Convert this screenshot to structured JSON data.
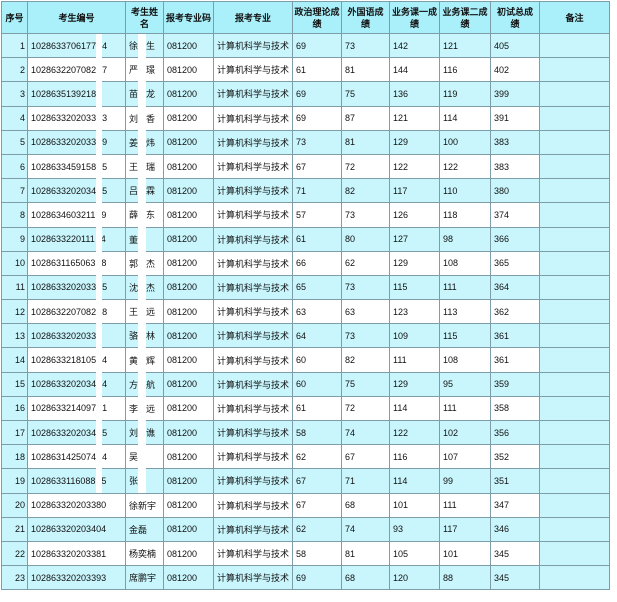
{
  "theme": {
    "header_bg": "#a9f0fb",
    "row_alt_bg": "#c9f6fd",
    "grid": "#7d9ea8"
  },
  "table": {
    "headers": [
      "序号",
      "考生编号",
      "考生姓名",
      "报考专业码",
      "报考专业",
      "政治理论成绩",
      "外国语成绩",
      "业务课一成绩",
      "业务课二成绩",
      "初试总成绩",
      "备注"
    ],
    "rows": [
      {
        "seq": "1",
        "id": "1028633706177",
        "id_tail": "4",
        "name": "徐",
        "name_tail": "生",
        "major_code": "081200",
        "major": "计算机科学与技术",
        "politics": "69",
        "foreign_language": "73",
        "course1": "142",
        "course2": "121",
        "total": "405"
      },
      {
        "seq": "2",
        "id": "1028632207082",
        "id_tail": "7",
        "name": "严",
        "name_tail": "璟",
        "major_code": "081200",
        "major": "计算机科学与技术",
        "politics": "61",
        "foreign_language": "81",
        "course1": "144",
        "course2": "116",
        "total": "402"
      },
      {
        "seq": "3",
        "id": "1028635139218",
        "name": "苗",
        "name_tail": "龙",
        "major_code": "081200",
        "major": "计算机科学与技术",
        "politics": "69",
        "foreign_language": "75",
        "course1": "136",
        "course2": "119",
        "total": "399"
      },
      {
        "seq": "4",
        "id": "1028633202033",
        "id_tail": "3",
        "name": "刘",
        "name_tail": "香",
        "major_code": "081200",
        "major": "计算机科学与技术",
        "politics": "69",
        "foreign_language": "87",
        "course1": "121",
        "course2": "114",
        "total": "391"
      },
      {
        "seq": "5",
        "id": "1028633202033",
        "id_tail": "9",
        "name": "姜",
        "name_tail": "炜",
        "major_code": "081200",
        "major": "计算机科学与技术",
        "politics": "73",
        "foreign_language": "81",
        "course1": "129",
        "course2": "100",
        "total": "383"
      },
      {
        "seq": "6",
        "id": "1028633459158",
        "id_tail": "5",
        "name": "王",
        "name_tail": "瑞",
        "major_code": "081200",
        "major": "计算机科学与技术",
        "politics": "67",
        "foreign_language": "72",
        "course1": "122",
        "course2": "122",
        "total": "383"
      },
      {
        "seq": "7",
        "id": "1028633202034",
        "id_tail": "5",
        "name": "吕",
        "name_tail": "霖",
        "major_code": "081200",
        "major": "计算机科学与技术",
        "politics": "71",
        "foreign_language": "82",
        "course1": "117",
        "course2": "110",
        "total": "380"
      },
      {
        "seq": "8",
        "id": "1028634603211",
        "id_tail": "9",
        "name": "薛",
        "name_tail": "东",
        "major_code": "081200",
        "major": "计算机科学与技术",
        "politics": "57",
        "foreign_language": "73",
        "course1": "126",
        "course2": "118",
        "total": "374"
      },
      {
        "seq": "9",
        "id": "1028633220111",
        "id_tail": "4",
        "name": "董",
        "major_code": "081200",
        "major": "计算机科学与技术",
        "politics": "61",
        "foreign_language": "80",
        "course1": "127",
        "course2": "98",
        "total": "366"
      },
      {
        "seq": "10",
        "id": "1028631165063",
        "id_tail": "8",
        "name": "郭",
        "name_tail": "杰",
        "major_code": "081200",
        "major": "计算机科学与技术",
        "politics": "66",
        "foreign_language": "62",
        "course1": "129",
        "course2": "108",
        "total": "365"
      },
      {
        "seq": "11",
        "id": "1028633202033",
        "id_tail": "5",
        "name": "沈",
        "name_tail": "杰",
        "major_code": "081200",
        "major": "计算机科学与技术",
        "politics": "65",
        "foreign_language": "73",
        "course1": "115",
        "course2": "111",
        "total": "364"
      },
      {
        "seq": "12",
        "id": "1028632207082",
        "id_tail": "8",
        "name": "王",
        "name_tail": "远",
        "major_code": "081200",
        "major": "计算机科学与技术",
        "politics": "63",
        "foreign_language": "63",
        "course1": "123",
        "course2": "113",
        "total": "362"
      },
      {
        "seq": "13",
        "id": "1028633202033",
        "name": "骆",
        "name_tail": "林",
        "major_code": "081200",
        "major": "计算机科学与技术",
        "politics": "64",
        "foreign_language": "73",
        "course1": "109",
        "course2": "115",
        "total": "361"
      },
      {
        "seq": "14",
        "id": "1028633218105",
        "id_tail": "4",
        "name": "黄",
        "name_tail": "辉",
        "major_code": "081200",
        "major": "计算机科学与技术",
        "politics": "60",
        "foreign_language": "82",
        "course1": "111",
        "course2": "108",
        "total": "361"
      },
      {
        "seq": "15",
        "id": "1028633202034",
        "id_tail": "4",
        "name": "方",
        "name_tail": "航",
        "major_code": "081200",
        "major": "计算机科学与技术",
        "politics": "60",
        "foreign_language": "75",
        "course1": "129",
        "course2": "95",
        "total": "359"
      },
      {
        "seq": "16",
        "id": "1028633214097",
        "id_tail": "1",
        "name": "李",
        "name_tail": "远",
        "major_code": "081200",
        "major": "计算机科学与技术",
        "politics": "61",
        "foreign_language": "72",
        "course1": "114",
        "course2": "111",
        "total": "358"
      },
      {
        "seq": "17",
        "id": "1028633202034",
        "id_tail": "5",
        "name": "刘",
        "name_tail": "谯",
        "major_code": "081200",
        "major": "计算机科学与技术",
        "politics": "58",
        "foreign_language": "74",
        "course1": "122",
        "course2": "102",
        "total": "356"
      },
      {
        "seq": "18",
        "id": "1028631425074",
        "id_tail": "4",
        "name": "吴",
        "major_code": "081200",
        "major": "计算机科学与技术",
        "politics": "62",
        "foreign_language": "67",
        "course1": "116",
        "course2": "107",
        "total": "352"
      },
      {
        "seq": "19",
        "id": "1028633116088",
        "id_tail": "5",
        "name": "张",
        "major_code": "081200",
        "major": "计算机科学与技术",
        "politics": "67",
        "foreign_language": "71",
        "course1": "114",
        "course2": "99",
        "total": "351"
      },
      {
        "seq": "20",
        "id": "102863320203380",
        "name": "徐新宇",
        "major_code": "081200",
        "major": "计算机科学与技术",
        "politics": "67",
        "foreign_language": "68",
        "course1": "101",
        "course2": "111",
        "total": "347"
      },
      {
        "seq": "21",
        "id": "102863320203404",
        "name": "金磊",
        "major_code": "081200",
        "major": "计算机科学与技术",
        "politics": "62",
        "foreign_language": "74",
        "course1": "93",
        "course2": "117",
        "total": "346"
      },
      {
        "seq": "22",
        "id": "102863320203381",
        "name": "杨奕楠",
        "major_code": "081200",
        "major": "计算机科学与技术",
        "politics": "58",
        "foreign_language": "81",
        "course1": "105",
        "course2": "101",
        "total": "345"
      },
      {
        "seq": "23",
        "id": "102863320203393",
        "name": "席鹏宇",
        "major_code": "081200",
        "major": "计算机科学与技术",
        "politics": "69",
        "foreign_language": "68",
        "course1": "120",
        "course2": "88",
        "total": "345"
      }
    ]
  }
}
